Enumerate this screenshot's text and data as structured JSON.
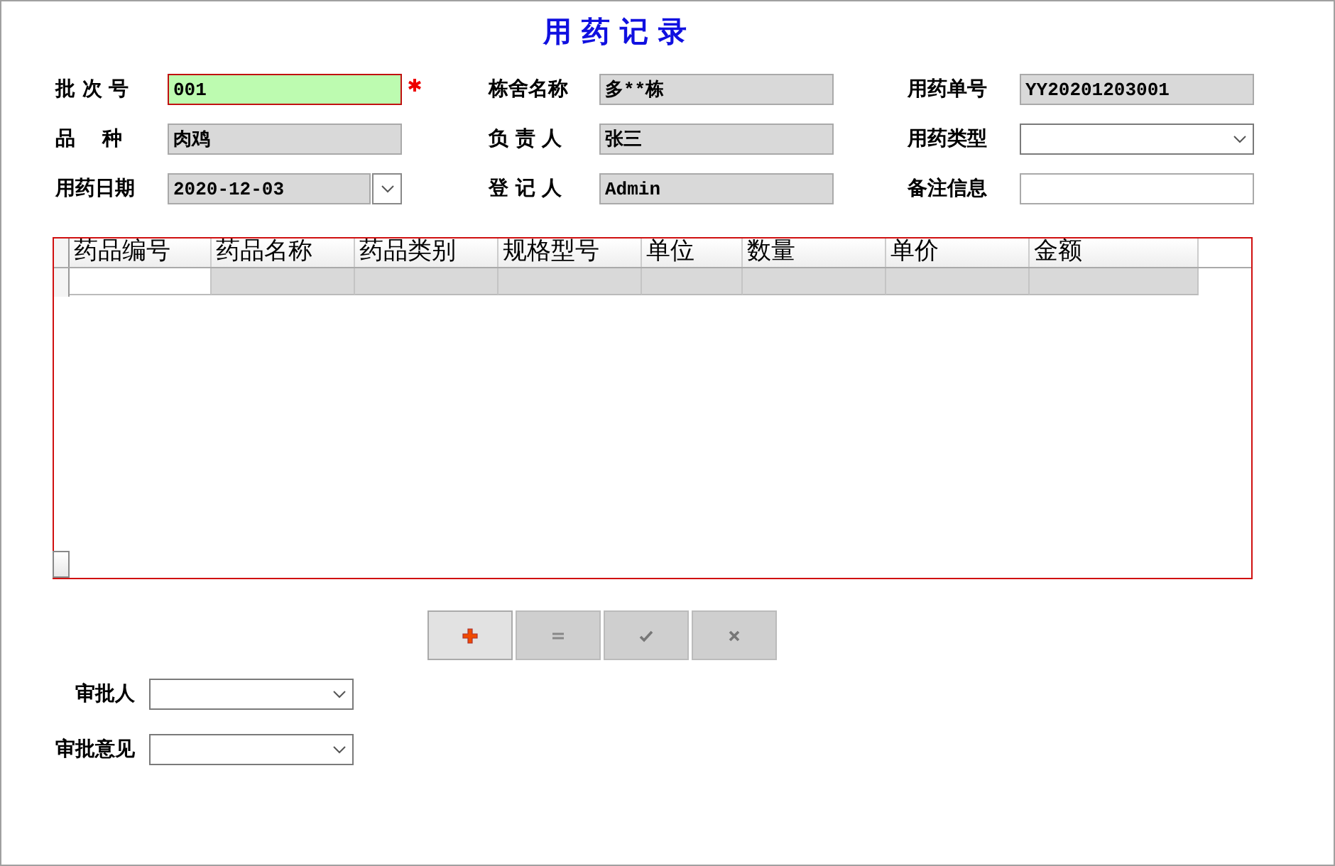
{
  "title": "用 药 记 录",
  "fields": [
    {
      "label": "批 次 号",
      "kind": "input",
      "value": "001",
      "required": true
    },
    {
      "label": "栋舍名称",
      "kind": "readonly",
      "value": "多**栋",
      "required": false
    },
    {
      "label": "用药单号",
      "kind": "readonly",
      "value": "YY20201203001",
      "required": false
    },
    {
      "label": "品　 种",
      "kind": "readonly",
      "value": "肉鸡",
      "required": false
    },
    {
      "label": "负 责 人",
      "kind": "readonly",
      "value": "张三",
      "required": false
    },
    {
      "label": "用药类型",
      "kind": "select",
      "required": false
    },
    {
      "label": "用药日期",
      "kind": "date",
      "value": "2020-12-03",
      "required": false
    },
    {
      "label": "登 记 人",
      "kind": "readonly",
      "value": "Admin",
      "required": false
    },
    {
      "label": "备注信息",
      "kind": "text",
      "required": false
    }
  ],
  "table": {
    "columns": [
      "药品编号",
      "药品名称",
      "药品类别",
      "规格型号",
      "单位",
      "数量",
      "单价",
      "金额"
    ]
  },
  "buttons": [
    {
      "kind": "add",
      "focused": true
    },
    {
      "kind": "remove",
      "focused": false
    },
    {
      "kind": "confirm",
      "focused": false
    },
    {
      "kind": "cancel",
      "focused": false
    }
  ],
  "approval": [
    {
      "label": "审批人",
      "kind": "select"
    },
    {
      "label": "审批意见",
      "kind": "select"
    }
  ]
}
